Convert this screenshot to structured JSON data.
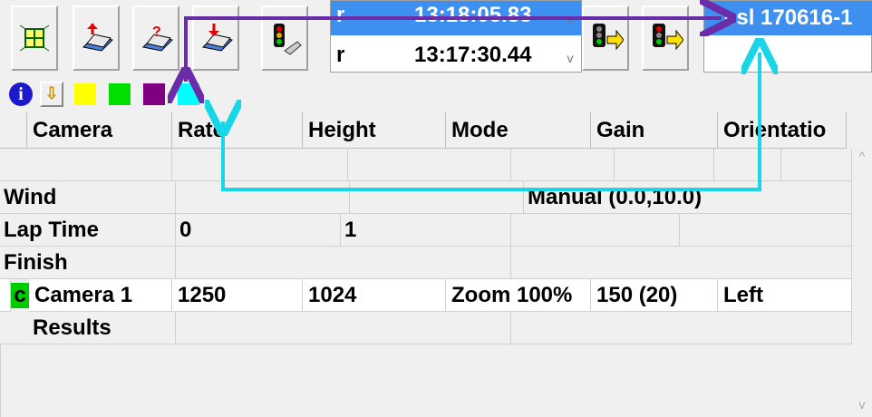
{
  "toolbar": {
    "buttons": [
      {
        "icon": "grid-target-icon"
      },
      {
        "icon": "upload-card-icon"
      },
      {
        "icon": "question-card-icon"
      },
      {
        "icon": "download-card-icon"
      },
      {
        "icon": "traffic-light-hand-icon"
      },
      {
        "icon": "traffic-light-go-icon"
      },
      {
        "icon": "traffic-light-next-icon"
      }
    ],
    "time_row1_label": "r",
    "time_row1_value": "13:18:05.83",
    "time_row2_label": "r",
    "time_row2_value": "13:17:30.44",
    "spin_up": "^",
    "spin_down": "v",
    "session": "csl 170616-1"
  },
  "swatches": {
    "info_label": "i",
    "sort_label": "⇩",
    "colors": [
      "#ffff00",
      "#00e000",
      "#800080",
      "#00ffff"
    ]
  },
  "grid": {
    "columns": [
      "Camera",
      "Rate",
      "Height",
      "Mode",
      "Gain",
      "Orientatio"
    ],
    "rows": [
      {
        "label": "",
        "cells": [
          "",
          "",
          "",
          "",
          "",
          ""
        ]
      },
      {
        "label": "Wind",
        "cells": [
          "",
          "",
          "Manual (0.0,10.0)"
        ]
      },
      {
        "label": "Lap Time",
        "cells": [
          "0",
          "1",
          "",
          ""
        ]
      },
      {
        "label": "Finish",
        "cells": [
          "",
          ""
        ]
      },
      {
        "marker": "c",
        "label": "Camera 1",
        "cells": [
          "1250",
          "1024",
          "Zoom 100%",
          "150  (20)",
          "Left"
        ]
      },
      {
        "label": "Results",
        "cells": [
          "",
          ""
        ]
      }
    ]
  },
  "colors": {
    "selection_blue": "#3d8ff0",
    "arrow_purple": "#6a2ca8",
    "arrow_cyan": "#19d6e6",
    "camera_marker": "#00cc00"
  }
}
